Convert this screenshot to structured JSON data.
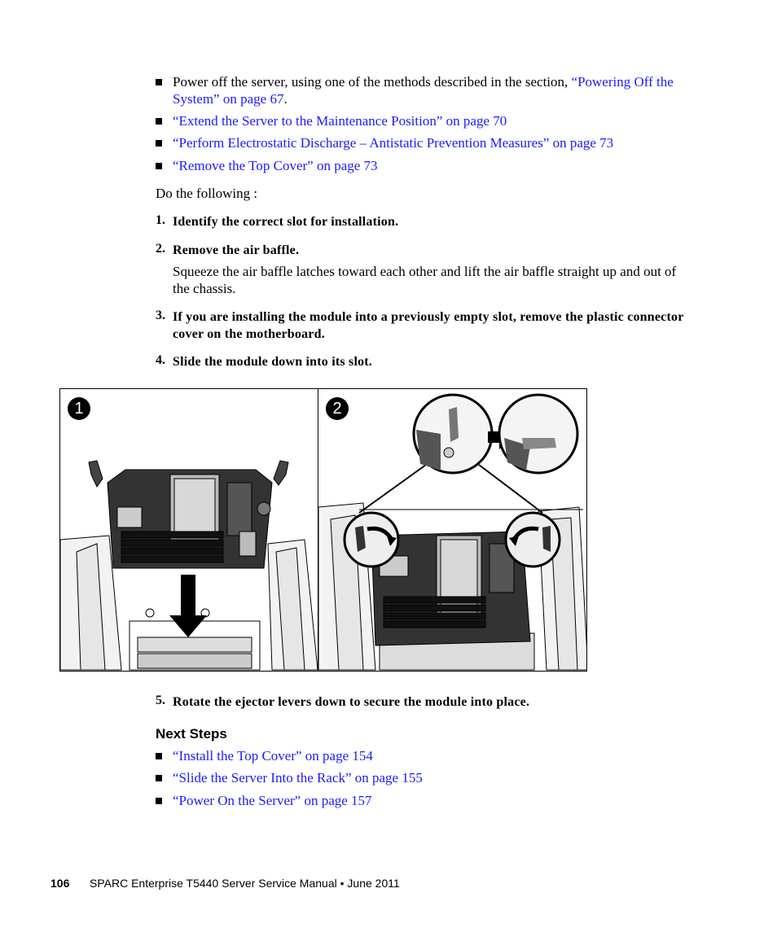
{
  "prerequisites": [
    {
      "plain_prefix": "Power off the server, using one of the methods described in the section, ",
      "link": "“Powering Off the System” on page 67",
      "suffix": "."
    },
    {
      "link": "“Extend the Server to the Maintenance Position” on page 70"
    },
    {
      "link": "“Perform Electrostatic Discharge – Antistatic Prevention Measures” on page 73"
    },
    {
      "link": "“Remove the Top Cover” on page 73"
    }
  ],
  "intro": "Do the following :",
  "steps": [
    {
      "num": "1.",
      "text": "Identify the correct slot for installation."
    },
    {
      "num": "2.",
      "text": "Remove the air baffle.",
      "detail": "Squeeze the air baffle latches toward each other and lift the air baffle straight up and out of the chassis."
    },
    {
      "num": "3.",
      "text": "If you are installing the module into a previously empty slot, remove the plastic connector cover on the motherboard."
    },
    {
      "num": "4.",
      "text": "Slide the module down into its slot."
    },
    {
      "num": "5.",
      "text": "Rotate the ejector levers down to secure the module into place."
    }
  ],
  "figure": {
    "panels": [
      {
        "badge": "1",
        "description": "Module being lowered into its motherboard slot (down arrow)"
      },
      {
        "badge": "2",
        "description": "Ejector levers rotated down; callouts show lever before and after"
      }
    ]
  },
  "next_steps": {
    "heading": "Next Steps",
    "links": [
      "“Install the Top Cover” on page 154",
      "“Slide the Server Into the Rack” on page 155",
      "“Power On the Server” on page 157"
    ]
  },
  "footer": {
    "page_number": "106",
    "title": "SPARC Enterprise T5440 Server Service Manual",
    "separator": "•",
    "date": "June 2011"
  }
}
